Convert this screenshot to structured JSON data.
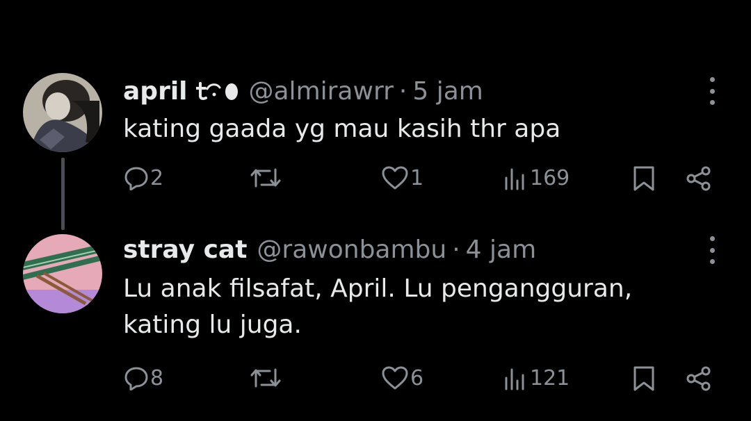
{
  "tweets": [
    {
      "display_name": "april",
      "badge_icon": "emoji-badge-icon",
      "handle": "@almirawrr",
      "separator": "·",
      "time": "5 jam",
      "text_lines": [
        "kating gaada yg mau kasih thr apa"
      ],
      "replies": "2",
      "reposts": "",
      "likes": "1",
      "views": "169"
    },
    {
      "display_name": "stray cat",
      "handle": "@rawonbambu",
      "separator": "·",
      "time": "4 jam",
      "text_lines": [
        "Lu anak filsafat, April. Lu pengangguran,",
        "kating lu juga."
      ],
      "replies": "8",
      "reposts": "",
      "likes": "6",
      "views": "121"
    }
  ],
  "colors": {
    "background": "#000000",
    "primary_text": "#e7e9ea",
    "secondary_text": "#8b9197",
    "thread_line": "#4a4e52"
  }
}
